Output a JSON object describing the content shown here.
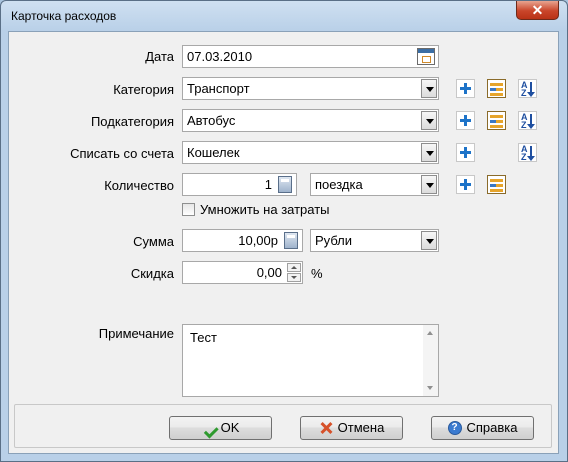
{
  "window": {
    "title": "Карточка расходов"
  },
  "date": {
    "label": "Дата",
    "value": "07.03.2010"
  },
  "category": {
    "label": "Категория",
    "value": "Транспорт"
  },
  "subcategory": {
    "label": "Подкатегория",
    "value": "Автобус"
  },
  "account": {
    "label": "Списать со счета",
    "value": "Кошелек"
  },
  "quantity": {
    "label": "Количество",
    "value": "1",
    "unit": "поездка"
  },
  "multiply": {
    "label": "Умножить на затраты",
    "checked": false
  },
  "amount": {
    "label": "Сумма",
    "value": "10,00р",
    "currency": "Рубли"
  },
  "discount": {
    "label": "Скидка",
    "value": "0,00",
    "suffix": "%"
  },
  "note": {
    "label": "Примечание",
    "value": "Тест"
  },
  "buttons": {
    "ok": "OK",
    "cancel": "Отмена",
    "help": "Справка"
  }
}
